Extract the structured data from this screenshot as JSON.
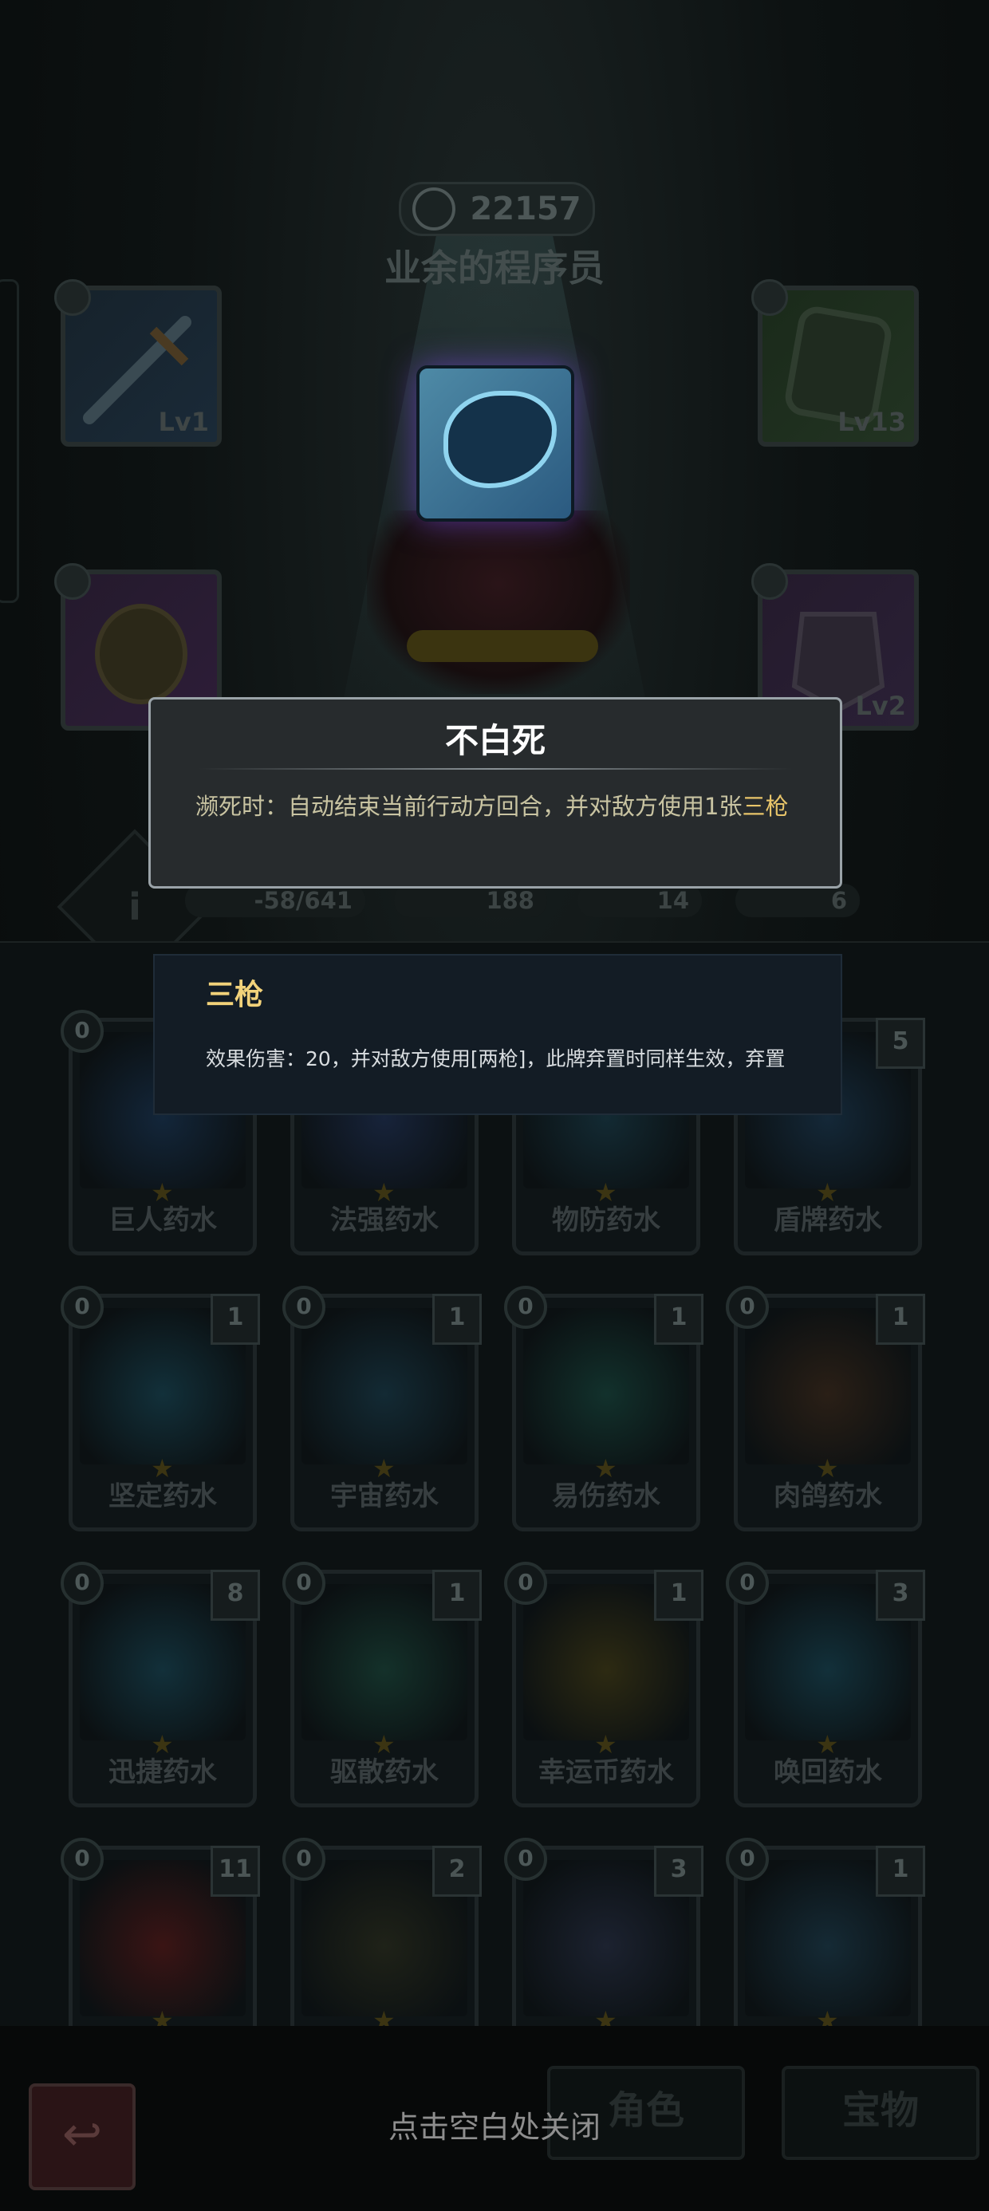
{
  "header": {
    "score": "22157",
    "player_name": "业余的程序员"
  },
  "equipment": [
    {
      "slot": "weapon",
      "level": "Lv1",
      "icon": "sword-icon"
    },
    {
      "slot": "shield",
      "level": "Lv13",
      "icon": "shield-icon"
    },
    {
      "slot": "gloves",
      "level": "",
      "icon": "gauntlet-icon"
    },
    {
      "slot": "armor",
      "level": "Lv2",
      "icon": "armor-icon"
    }
  ],
  "stats": {
    "hp": "-58/641",
    "attack": "188",
    "defense": "14",
    "coins": "6",
    "info": "i"
  },
  "tooltip_primary": {
    "title": "不白死",
    "desc_prefix": "濒死时：自动结束当前行动方回合，并对敌方使用1张",
    "desc_keyword": "三枪"
  },
  "tooltip_secondary": {
    "title": "三枪",
    "desc": "效果伤害：20，并对敌方使用[两枪]，此牌弃置时同样生效，弃置"
  },
  "cards": [
    {
      "name": "巨人药水",
      "cost": "0",
      "count": ""
    },
    {
      "name": "法强药水",
      "cost": "0",
      "count": ""
    },
    {
      "name": "物防药水",
      "cost": "0",
      "count": ""
    },
    {
      "name": "盾牌药水",
      "cost": "0",
      "count": "5"
    },
    {
      "name": "坚定药水",
      "cost": "0",
      "count": "1"
    },
    {
      "name": "宇宙药水",
      "cost": "0",
      "count": "1"
    },
    {
      "name": "易伤药水",
      "cost": "0",
      "count": "1"
    },
    {
      "name": "肉鸽药水",
      "cost": "0",
      "count": "1"
    },
    {
      "name": "迅捷药水",
      "cost": "0",
      "count": "8"
    },
    {
      "name": "驱散药水",
      "cost": "0",
      "count": "1"
    },
    {
      "name": "幸运币药水",
      "cost": "0",
      "count": "1"
    },
    {
      "name": "唤回药水",
      "cost": "0",
      "count": "3"
    },
    {
      "name": "",
      "cost": "0",
      "count": "11"
    },
    {
      "name": "",
      "cost": "0",
      "count": "2"
    },
    {
      "name": "",
      "cost": "0",
      "count": "3"
    },
    {
      "name": "",
      "cost": "0",
      "count": "1"
    }
  ],
  "bottom": {
    "close_hint": "点击空白处关闭",
    "tab_role": "角色",
    "tab_treasure": "宝物",
    "back_icon": "back-arrow-icon"
  },
  "colors": {
    "tooltip_title": "#ffffff",
    "keyword": "#e8c56a",
    "secondary_title": "#f2d27a"
  }
}
